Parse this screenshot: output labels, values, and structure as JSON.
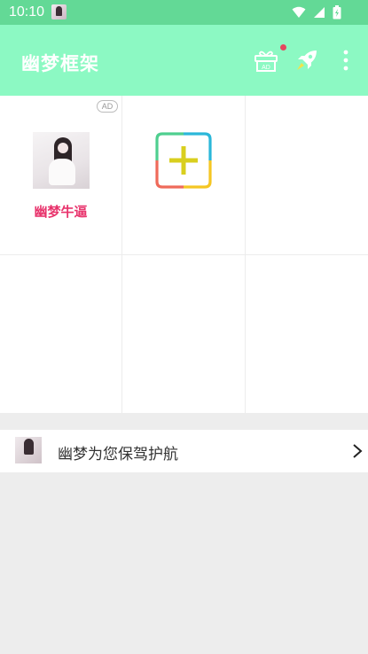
{
  "status_bar": {
    "time": "10:10",
    "icons": [
      "photo-thumbnail-icon",
      "wifi-icon",
      "signal-icon",
      "battery-icon"
    ]
  },
  "app_bar": {
    "title": "幽梦框架",
    "background": "#8cf9c3",
    "gift_badge": "AD",
    "notification_dot_color": "#e5485f"
  },
  "grid": {
    "ad_badge": "AD",
    "apps": [
      {
        "label": "幽梦牛逼",
        "label_color": "#e8336c",
        "icon": "girl-avatar-icon"
      }
    ],
    "add_icon": "add-app-icon"
  },
  "footer": {
    "text": "幽梦为您保驾护航",
    "icon": "girl-avatar-icon"
  }
}
